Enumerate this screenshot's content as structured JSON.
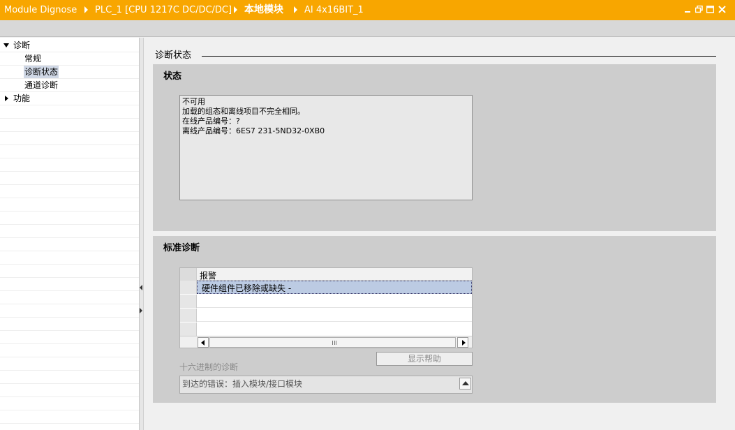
{
  "titlebar": {
    "crumbs": [
      "Module Dignose",
      "PLC_1 [CPU 1217C DC/DC/DC]",
      "本地模块",
      "AI 4x16BIT_1"
    ],
    "bg_color": "#f8a600"
  },
  "tree": {
    "items": [
      {
        "label": "诊断",
        "expanded": true
      },
      {
        "label": "常规"
      },
      {
        "label": "诊断状态",
        "selected": true
      },
      {
        "label": "通道诊断"
      },
      {
        "label": "功能",
        "expanded": false
      }
    ]
  },
  "main": {
    "section_title": "诊断状态",
    "status": {
      "title": "状态",
      "lines": [
        "不可用",
        "加载的组态和离线项目不完全相同。",
        "在线产品编号：?",
        "离线产品编号：6ES7 231-5ND32-0XB0"
      ]
    },
    "standard_diag": {
      "title": "标准诊断",
      "column_header": "报警",
      "rows": [
        "硬件组件已移除或缺失 -"
      ],
      "help_button": "显示帮助",
      "hex_label": "十六进制的诊断",
      "hex_value": "到达的错误：插入模块/接口模块"
    }
  }
}
